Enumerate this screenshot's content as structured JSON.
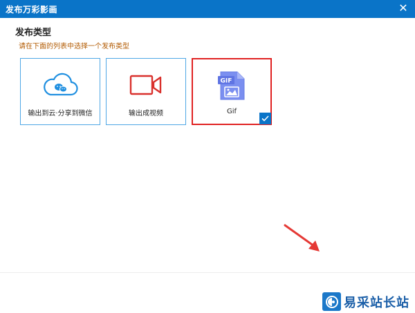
{
  "window": {
    "title": "发布万彩影画",
    "close_icon": "close-icon"
  },
  "section": {
    "title": "发布类型",
    "hint": "请在下面的列表中选择一个发布类型"
  },
  "cards": [
    {
      "label": "输出到云·分享到微信",
      "icon": "cloud-wechat-icon",
      "selected": false
    },
    {
      "label": "输出成视频",
      "icon": "video-camera-icon",
      "selected": false
    },
    {
      "label": "Gif",
      "icon": "gif-file-icon",
      "selected": true
    }
  ],
  "gif_icon_text": "GIF",
  "colors": {
    "titlebar": "#0a74c8",
    "card_border": "#4da6e5",
    "selected_border": "#e02020",
    "hint_text": "#b25a00",
    "arrow": "#e53935"
  },
  "watermark": {
    "text": "易采站长站"
  }
}
